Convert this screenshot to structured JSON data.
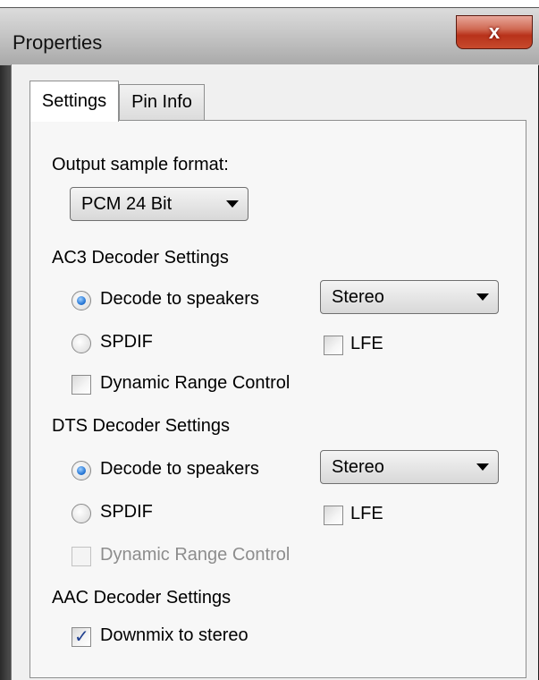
{
  "window": {
    "title": "Properties",
    "close_glyph": "x"
  },
  "tabs": [
    {
      "label": "Settings",
      "active": true
    },
    {
      "label": "Pin Info",
      "active": false
    }
  ],
  "output": {
    "label": "Output sample format:",
    "selected": "PCM 24 Bit"
  },
  "ac3": {
    "heading": "AC3 Decoder Settings",
    "decode_label": "Decode to speakers",
    "speaker_selected": "Stereo",
    "spdif_label": "SPDIF",
    "lfe_label": "LFE",
    "drc_label": "Dynamic Range Control"
  },
  "dts": {
    "heading": "DTS Decoder Settings",
    "decode_label": "Decode to speakers",
    "speaker_selected": "Stereo",
    "spdif_label": "SPDIF",
    "lfe_label": "LFE",
    "drc_label": "Dynamic Range Control"
  },
  "aac": {
    "heading": "AAC Decoder Settings",
    "downmix_label": "Downmix to stereo"
  },
  "icons": {
    "check": "✓"
  }
}
